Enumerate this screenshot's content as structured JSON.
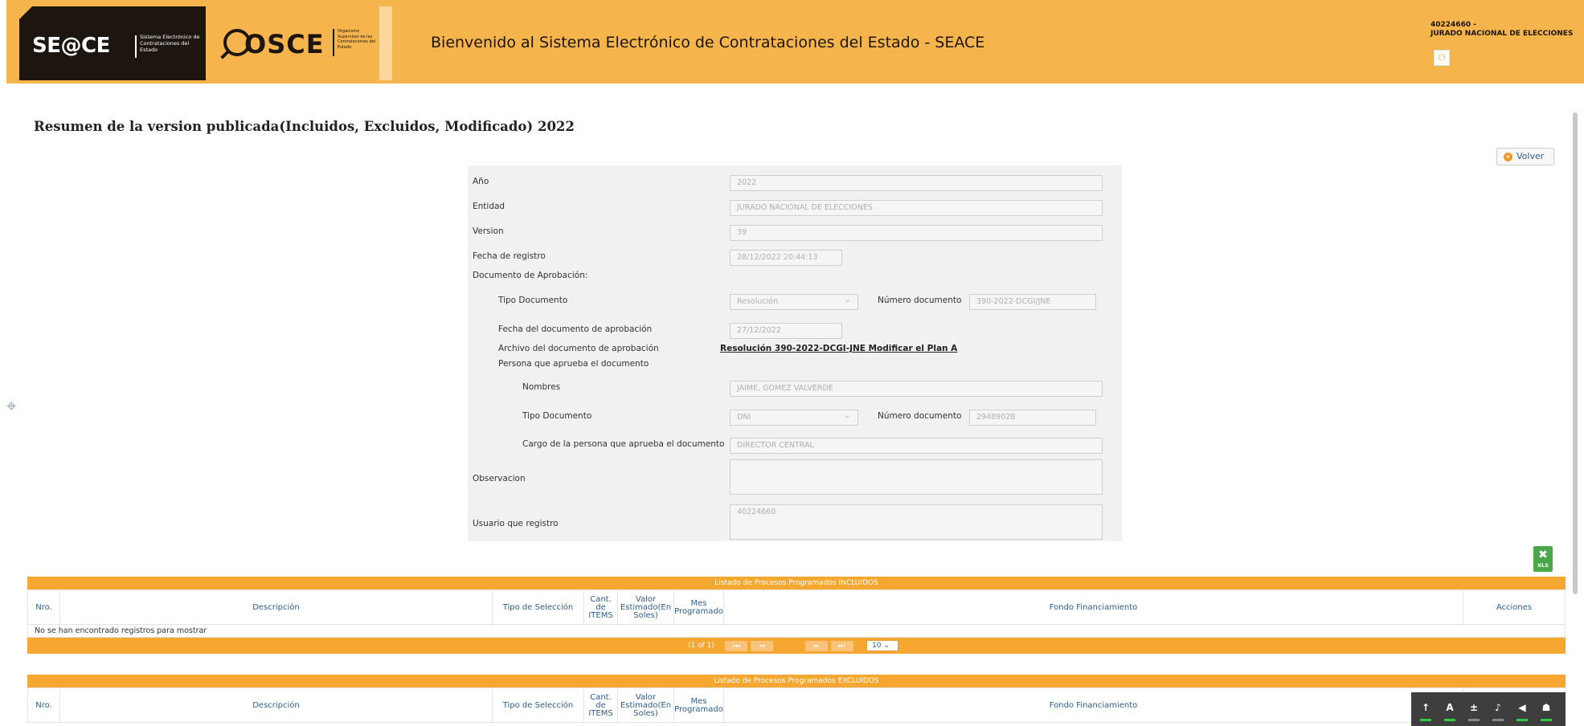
{
  "header": {
    "seace_brand": "SE@CE",
    "seace_sub": "Sistema Electrónico de Contrataciones del Estado",
    "osce_brand": "OSCE",
    "osce_sub": "Organismo Supervisor de las Contrataciones del Estado",
    "welcome": "Bienvenido al Sistema Electrónico de Contrataciones del Estado - SEACE",
    "user_id": "40224660 -",
    "user_entity": "JURADO NACIONAL DE ELECCIONES",
    "power_icon": "power-icon"
  },
  "page_title": "Resumen de la version publicada(Incluidos, Excluidos, Modificado) 2022",
  "volver_label": "Volver",
  "form": {
    "anio_label": "Año",
    "anio_value": "2022",
    "entidad_label": "Entidad",
    "entidad_value": "JURADO NACIONAL DE ELECCIONES",
    "version_label": "Version",
    "version_value": "39",
    "fecha_registro_label": "Fecha de registro",
    "fecha_registro_value": "28/12/2022 20:44:13",
    "doc_aprobacion_label": "Documento de Aprobación:",
    "tipo_doc_label": "Tipo Documento",
    "tipo_doc_value": "Resolución",
    "num_doc_label": "Número documento",
    "num_doc_value": "390-2022-DCGI/JNE",
    "fecha_doc_label": "Fecha del documento de aprobación",
    "fecha_doc_value": "27/12/2022",
    "archivo_label": "Archivo del documento de aprobación",
    "archivo_link": "Resolución 390-2022-DCGI-JNE Modificar el Plan A",
    "persona_label": "Persona que aprueba el documento",
    "nombres_label": "Nombres",
    "nombres_value": "JAIME, GOMEZ VALVERDE",
    "persona_tipo_doc_label": "Tipo Documento",
    "persona_tipo_doc_value": "DNI",
    "persona_num_doc_label": "Número documento",
    "persona_num_doc_value": "29489028",
    "cargo_label": "Cargo de la persona que aprueba el documento",
    "cargo_value": "DIRECTOR CENTRAL",
    "observacion_label": "Observacion",
    "observacion_value": "",
    "usuario_label": "Usuario que registro",
    "usuario_value": "40224660"
  },
  "export_icon": "xls-export-icon",
  "export_label": "XLS",
  "columns": {
    "nro": "Nro.",
    "descripcion": "Descripción",
    "tipo_seleccion": "Tipo de Selección",
    "cant_items": "Cant. de ITEMS",
    "valor_estimado": "Valor Estimado(En Soles)",
    "mes_programado": "Mes Programado",
    "fondo": "Fondo Financiamiento",
    "acciones": "Acciones"
  },
  "incluidos": {
    "caption": "Listado de Procesos Programados INCLUIDOS",
    "empty_message": "No se han encontrado registros para mostrar",
    "page_info": "(1 of 1)",
    "first": "|◂◂",
    "prev": "◂◂",
    "next": "▸▸",
    "last": "▸▸|",
    "rows_per_page": "10"
  },
  "excluidos": {
    "caption": "Listado de Procesos Programados EXCLUIDOS"
  },
  "accessibility": {
    "increase_font": "↑",
    "font_a": "A",
    "decrease_font": "±",
    "icons": [
      "text-size-up-icon",
      "font-icon",
      "text-size-down-icon",
      "voice-icon",
      "speaker-icon",
      "accessibility-icon"
    ]
  }
}
